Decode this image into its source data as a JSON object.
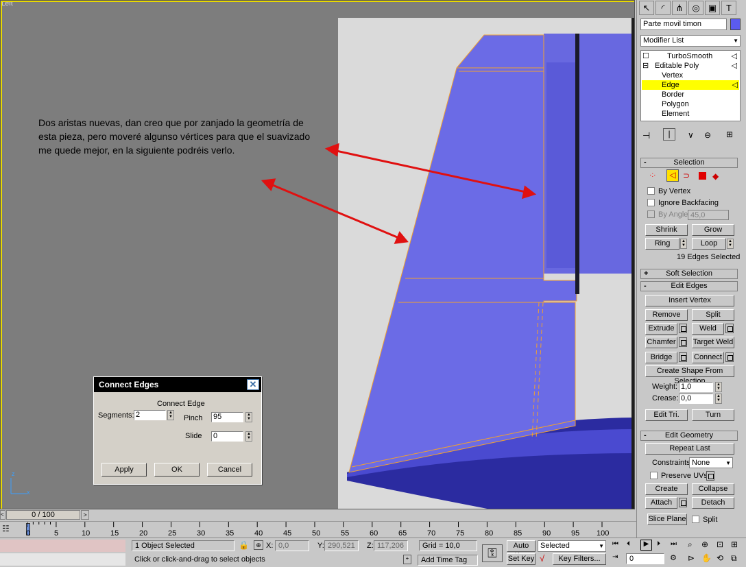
{
  "viewport": {
    "label": "Left",
    "annotation": "Dos aristas nuevas, dan creo que por zanjado la geometría de esta pieza, pero moveré algunso vértices para que el suavizado me quede mejor, en la siguiente podréis verlo.",
    "axis_x": "x",
    "axis_z": "z",
    "accent_color": "#6b6be6",
    "arrow_color": "#e01010",
    "edge_color": "#f0a030"
  },
  "dialog": {
    "title": "Connect Edges",
    "group": "Connect Edge",
    "segments_label": "Segments:",
    "segments_value": "2",
    "pinch_label": "Pinch",
    "pinch_value": "95",
    "slide_label": "Slide",
    "slide_value": "0",
    "apply": "Apply",
    "ok": "OK",
    "cancel": "Cancel"
  },
  "panel": {
    "object_name": "Parte movil timon",
    "modifier_list": "Modifier List",
    "stack": [
      {
        "label": "TurboSmooth"
      },
      {
        "label": "Editable Poly"
      },
      {
        "label": "Vertex"
      },
      {
        "label": "Edge"
      },
      {
        "label": "Border"
      },
      {
        "label": "Polygon"
      },
      {
        "label": "Element"
      }
    ],
    "selection": {
      "title": "Selection",
      "by_vertex": "By Vertex",
      "ignore_backfacing": "Ignore Backfacing",
      "by_angle": "By Angle:",
      "by_angle_value": "45,0",
      "shrink": "Shrink",
      "grow": "Grow",
      "ring": "Ring",
      "loop": "Loop",
      "status": "19 Edges Selected"
    },
    "soft_selection": "Soft Selection",
    "edit_edges": {
      "title": "Edit Edges",
      "insert_vertex": "Insert Vertex",
      "remove": "Remove",
      "split": "Split",
      "extrude": "Extrude",
      "weld": "Weld",
      "chamfer": "Chamfer",
      "target_weld": "Target Weld",
      "bridge": "Bridge",
      "connect": "Connect",
      "create_shape": "Create Shape From Selection",
      "weight_label": "Weight:",
      "weight_value": "1,0",
      "crease_label": "Crease:",
      "crease_value": "0,0",
      "edit_tri": "Edit Tri.",
      "turn": "Turn"
    },
    "edit_geometry": {
      "title": "Edit Geometry",
      "repeat_last": "Repeat Last",
      "constraints_label": "Constraints:",
      "constraints_value": "None",
      "preserve_uvs": "Preserve UVs",
      "create": "Create",
      "collapse": "Collapse",
      "attach": "Attach",
      "detach": "Detach",
      "slice_plane": "Slice Plane",
      "split": "Split"
    }
  },
  "timeline": {
    "frame": "0 / 100",
    "ticks": [
      "0",
      "5",
      "10",
      "15",
      "20",
      "25",
      "30",
      "35",
      "40",
      "45",
      "50",
      "55",
      "60",
      "65",
      "70",
      "75",
      "80",
      "85",
      "90",
      "95",
      "100"
    ]
  },
  "status": {
    "selected": "1 Object Selected",
    "prompt": "Click or click-and-drag to select objects",
    "x_label": "X:",
    "x_value": "0,0",
    "y_label": "Y:",
    "y_value": "290,521",
    "z_label": "Z:",
    "z_value": "117,206",
    "grid": "Grid = 10,0",
    "add_time_tag": "Add Time Tag",
    "auto_key": "Auto Key",
    "set_key": "Set Key",
    "selected_dropdown": "Selected",
    "key_filters": "Key Filters...",
    "frame_value": "0"
  }
}
